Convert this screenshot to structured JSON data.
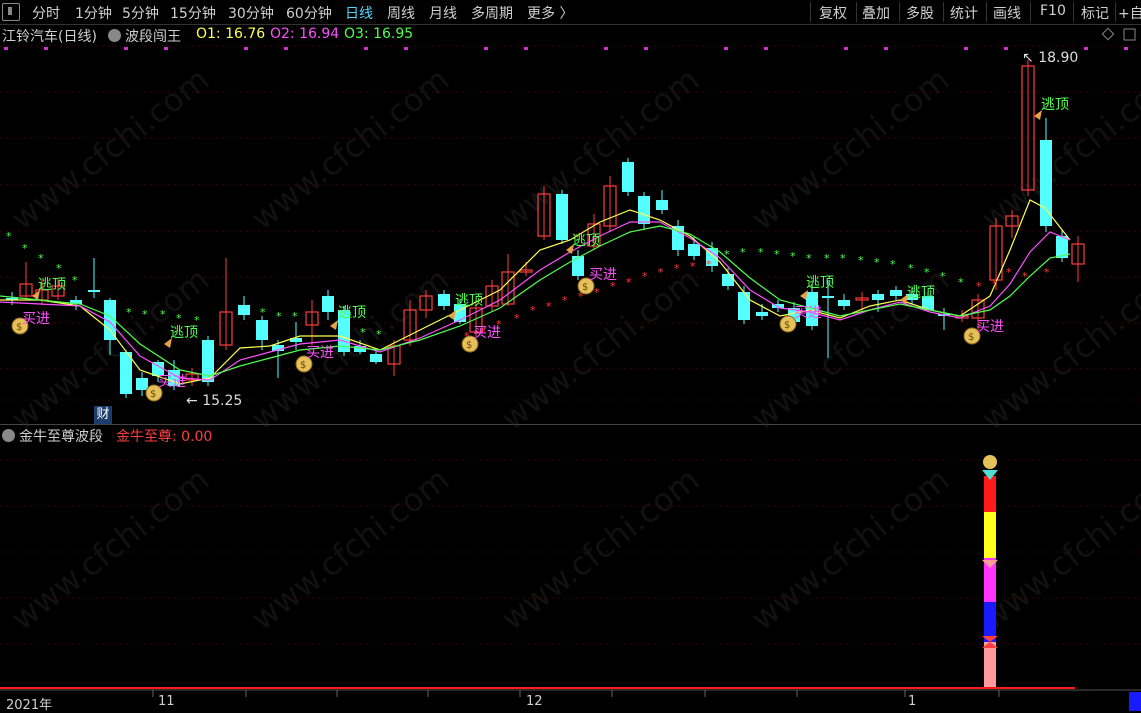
{
  "toolbar": {
    "periods": [
      "分时",
      "1分钟",
      "5分钟",
      "15分钟",
      "30分钟",
      "60分钟",
      "日线",
      "周线",
      "月线",
      "多周期",
      "更多 〉"
    ],
    "active_period": "日线",
    "right_tools": [
      "复权",
      "叠加",
      "多股",
      "统计",
      "画线",
      "F10",
      "标记",
      "+自"
    ]
  },
  "main_panel": {
    "stock": "江铃汽车(日线)",
    "indicator_name": "波段闯王",
    "o1_label": "O1: 16.76",
    "o2_label": "O2: 16.94",
    "o3_label": "O3: 16.95",
    "high_label": "18.90",
    "low_label": "15.25",
    "cai_badge": "财",
    "buy_label": "买进",
    "sell_label": "逃顶"
  },
  "sub_panel": {
    "indicator_name": "金牛至尊波段",
    "value_label": "金牛至尊: 0.00"
  },
  "time_axis": {
    "labels": [
      "2021年",
      "11",
      "12",
      "1"
    ]
  },
  "watermark": "www.cfchi.com",
  "colors": {
    "up": "#ff3d3d",
    "down": "#54ffff",
    "ma1": "#ffff4f",
    "ma2": "#ff4fff",
    "ma3": "#4fff4f",
    "active": "#4fd7ff"
  }
}
